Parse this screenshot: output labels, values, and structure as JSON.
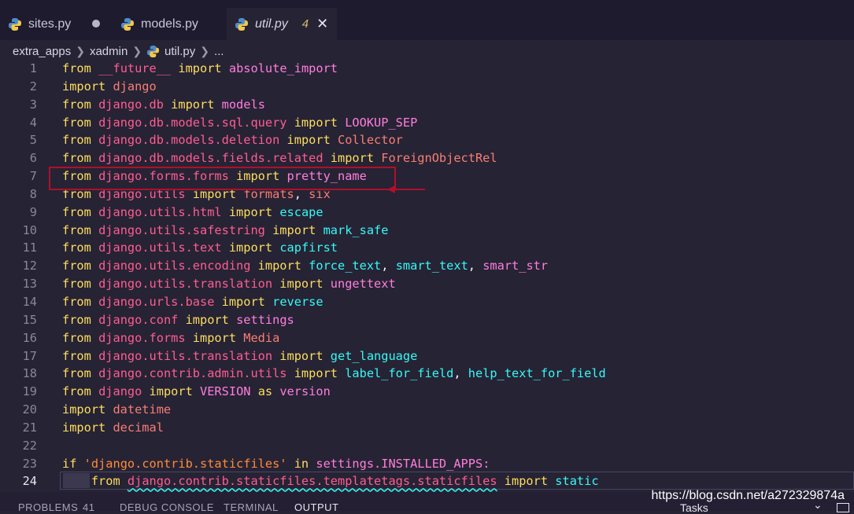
{
  "tabs": [
    {
      "label": "sites.py"
    },
    {
      "label": "models.py"
    },
    {
      "label": "util.py",
      "badge": "4",
      "close": "✕"
    }
  ],
  "breadcrumb": {
    "folder1": "extra_apps",
    "folder2": "xadmin",
    "file": "util.py",
    "more": "..."
  },
  "code_lines": [
    {
      "n": "1",
      "tokens": [
        [
          "from ",
          "kw"
        ],
        [
          "__future__",
          "mod"
        ],
        [
          " import ",
          "kw"
        ],
        [
          "absolute_import",
          "pk"
        ]
      ]
    },
    {
      "n": "2",
      "tokens": [
        [
          "import ",
          "kw"
        ],
        [
          "django",
          "imp"
        ]
      ]
    },
    {
      "n": "3",
      "tokens": [
        [
          "from ",
          "kw"
        ],
        [
          "django.db",
          "mod"
        ],
        [
          " import ",
          "kw"
        ],
        [
          "models",
          "pk"
        ]
      ]
    },
    {
      "n": "4",
      "tokens": [
        [
          "from ",
          "kw"
        ],
        [
          "django.db.models.sql.query",
          "mod"
        ],
        [
          " import ",
          "kw"
        ],
        [
          "LOOKUP_SEP",
          "pk"
        ]
      ]
    },
    {
      "n": "5",
      "tokens": [
        [
          "from ",
          "kw"
        ],
        [
          "django.db.models.deletion",
          "mod"
        ],
        [
          " import ",
          "kw"
        ],
        [
          "Collector",
          "imp"
        ]
      ]
    },
    {
      "n": "6",
      "tokens": [
        [
          "from ",
          "kw"
        ],
        [
          "django.db.models.fields.related",
          "mod"
        ],
        [
          " import ",
          "kw"
        ],
        [
          "ForeignObjectRel",
          "imp"
        ]
      ]
    },
    {
      "n": "7",
      "tokens": [
        [
          "from ",
          "kw"
        ],
        [
          "django.forms.forms",
          "mod"
        ],
        [
          " import ",
          "kw"
        ],
        [
          "pretty_name",
          "pk"
        ]
      ]
    },
    {
      "n": "8",
      "tokens": [
        [
          "from ",
          "kw"
        ],
        [
          "django.utils",
          "mod"
        ],
        [
          " import ",
          "kw"
        ],
        [
          "formats",
          "imp"
        ],
        [
          ", ",
          "pl"
        ],
        [
          "six",
          "imp"
        ]
      ]
    },
    {
      "n": "9",
      "tokens": [
        [
          "from ",
          "kw"
        ],
        [
          "django.utils.html",
          "mod"
        ],
        [
          " import ",
          "kw"
        ],
        [
          "escape",
          "cy"
        ]
      ]
    },
    {
      "n": "10",
      "tokens": [
        [
          "from ",
          "kw"
        ],
        [
          "django.utils.safestring",
          "mod"
        ],
        [
          " import ",
          "kw"
        ],
        [
          "mark_safe",
          "cy"
        ]
      ]
    },
    {
      "n": "11",
      "tokens": [
        [
          "from ",
          "kw"
        ],
        [
          "django.utils.text",
          "mod"
        ],
        [
          " import ",
          "kw"
        ],
        [
          "capfirst",
          "cy"
        ]
      ]
    },
    {
      "n": "12",
      "tokens": [
        [
          "from ",
          "kw"
        ],
        [
          "django.utils.encoding",
          "mod"
        ],
        [
          " import ",
          "kw"
        ],
        [
          "force_text",
          "cy"
        ],
        [
          ", ",
          "pl"
        ],
        [
          "smart_text",
          "cy"
        ],
        [
          ", ",
          "pl"
        ],
        [
          "smart_str",
          "pk"
        ]
      ]
    },
    {
      "n": "13",
      "tokens": [
        [
          "from ",
          "kw"
        ],
        [
          "django.utils.translation",
          "mod"
        ],
        [
          " import ",
          "kw"
        ],
        [
          "ungettext",
          "pk"
        ]
      ]
    },
    {
      "n": "14",
      "tokens": [
        [
          "from ",
          "kw"
        ],
        [
          "django.urls.base",
          "mod"
        ],
        [
          " import ",
          "kw"
        ],
        [
          "reverse",
          "cy"
        ]
      ]
    },
    {
      "n": "15",
      "tokens": [
        [
          "from ",
          "kw"
        ],
        [
          "django.conf",
          "mod"
        ],
        [
          " import ",
          "kw"
        ],
        [
          "settings",
          "pk"
        ]
      ]
    },
    {
      "n": "16",
      "tokens": [
        [
          "from ",
          "kw"
        ],
        [
          "django.forms",
          "mod"
        ],
        [
          " import ",
          "kw"
        ],
        [
          "Media",
          "imp"
        ]
      ]
    },
    {
      "n": "17",
      "tokens": [
        [
          "from ",
          "kw"
        ],
        [
          "django.utils.translation",
          "mod"
        ],
        [
          " import ",
          "kw"
        ],
        [
          "get_language",
          "cy"
        ]
      ]
    },
    {
      "n": "18",
      "tokens": [
        [
          "from ",
          "kw"
        ],
        [
          "django.contrib.admin.utils",
          "mod"
        ],
        [
          " import ",
          "kw"
        ],
        [
          "label_for_field",
          "cy"
        ],
        [
          ", ",
          "pl"
        ],
        [
          "help_text_for_field",
          "cy"
        ]
      ]
    },
    {
      "n": "19",
      "tokens": [
        [
          "from ",
          "kw"
        ],
        [
          "django",
          "mod"
        ],
        [
          " import ",
          "kw"
        ],
        [
          "VERSION",
          "pk"
        ],
        [
          " as ",
          "kw"
        ],
        [
          "version",
          "pk"
        ]
      ]
    },
    {
      "n": "20",
      "tokens": [
        [
          "import ",
          "kw"
        ],
        [
          "datetime",
          "imp"
        ]
      ]
    },
    {
      "n": "21",
      "tokens": [
        [
          "import ",
          "kw"
        ],
        [
          "decimal",
          "imp"
        ]
      ]
    },
    {
      "n": "22",
      "tokens": []
    },
    {
      "n": "23",
      "tokens": [
        [
          "if ",
          "kw"
        ],
        [
          "'django.contrib.staticfiles'",
          "st"
        ],
        [
          " in ",
          "kw"
        ],
        [
          "settings",
          "pk"
        ],
        [
          ".INSTALLED_APPS:",
          "pk"
        ]
      ]
    },
    {
      "n": "24",
      "tokens": [
        [
          "    ",
          "pl"
        ],
        [
          "from ",
          "kw"
        ],
        [
          "django.contrib.staticfiles.templatetags.staticfiles",
          "mod wavy"
        ],
        [
          " import ",
          "kw"
        ],
        [
          "static",
          "cy"
        ]
      ]
    }
  ],
  "panel": {
    "problems": "PROBLEMS",
    "problems_count": "41",
    "debug": "DEBUG CONSOLE",
    "terminal": "TERMINAL",
    "output": "OUTPUT",
    "tasks": "Tasks",
    "watermark": "https://blog.csdn.net/a272329874a"
  },
  "colors": {
    "background": "#262335",
    "keyword": "#fede5d",
    "module": "#ff5d8f",
    "annotation": "#b0102a"
  }
}
